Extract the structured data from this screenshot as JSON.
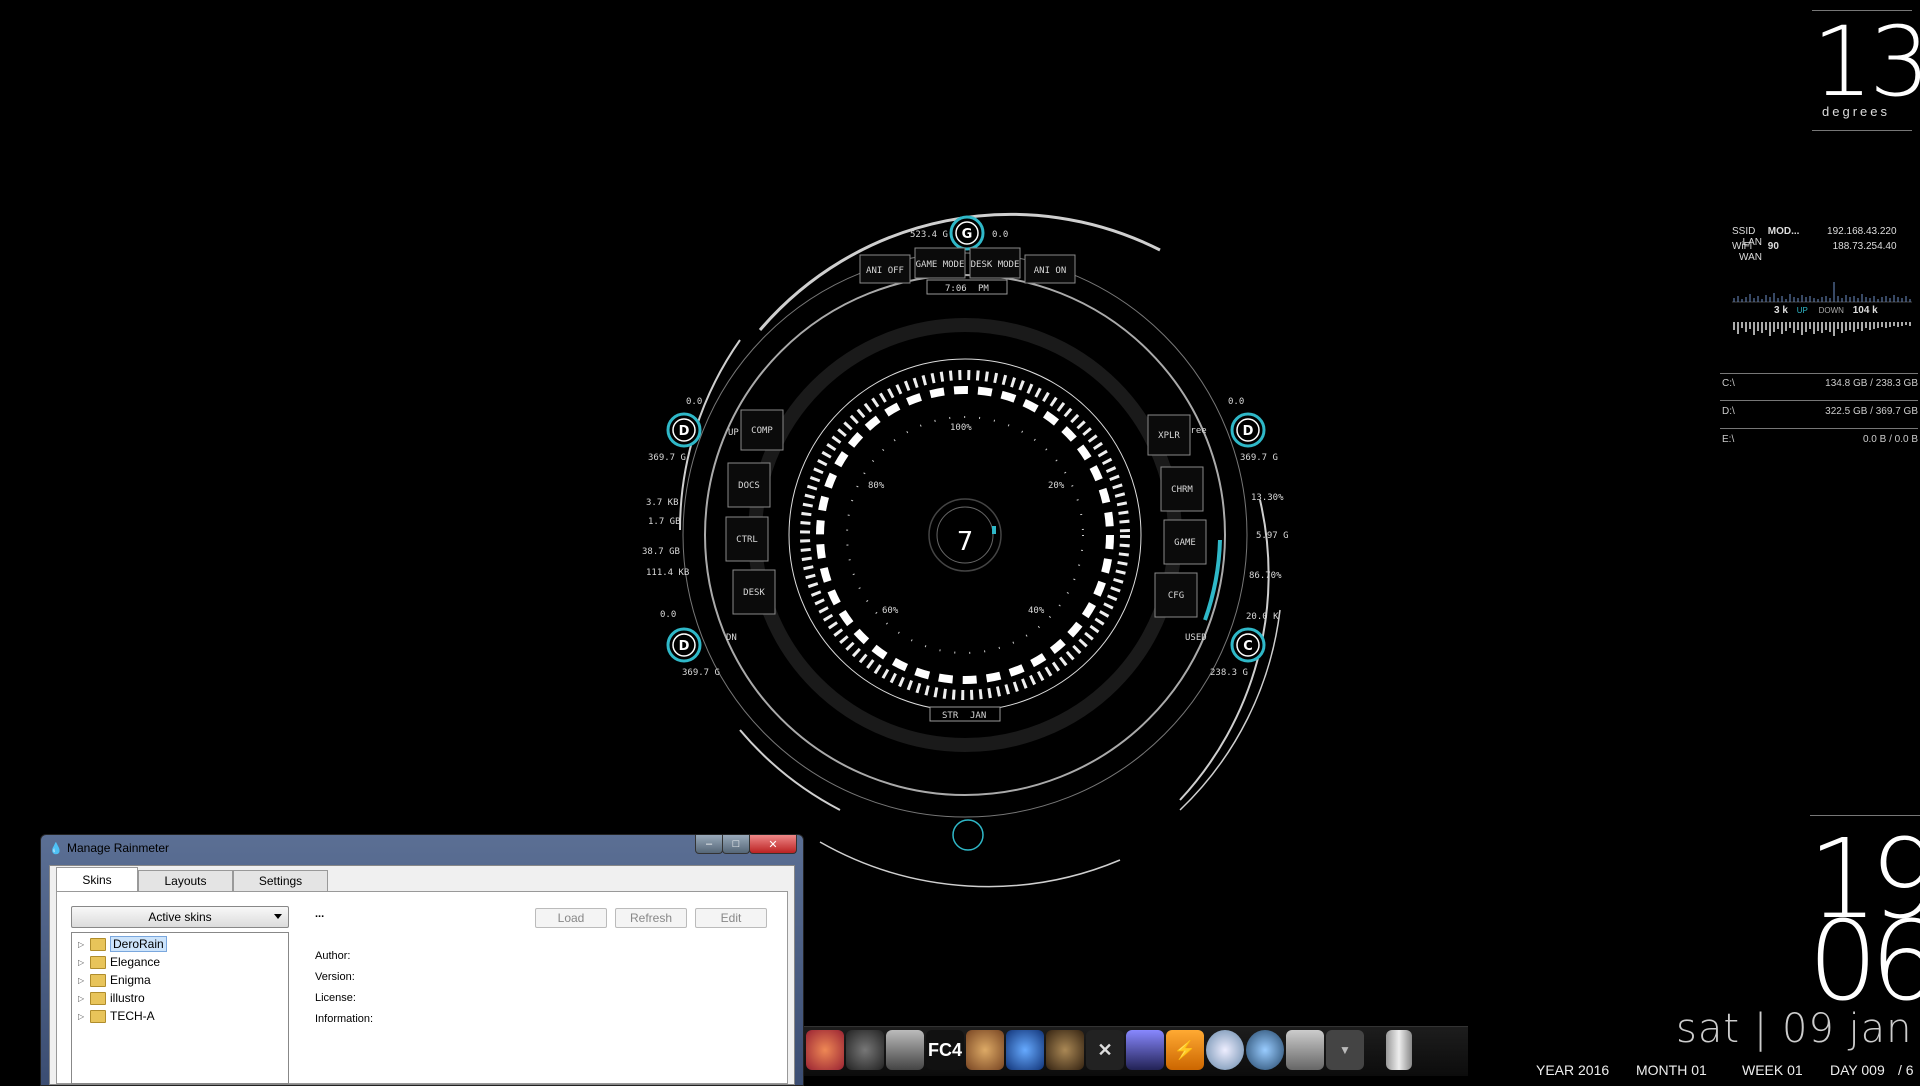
{
  "hud": {
    "top_label": "G",
    "top_left_value": "523.4 G",
    "top_right_value": "0.0",
    "left_disks": [
      {
        "letter": "D",
        "value_top": "0.0",
        "value_bottom": "369.7 G"
      },
      {
        "letter": "D",
        "value_top": "0.0",
        "value_bottom": "369.7 G"
      }
    ],
    "right_disks": [
      {
        "letter": "D",
        "value_top": "0.0",
        "value_bottom": "369.7 G"
      },
      {
        "letter": "C",
        "value_top": "20.0 K",
        "value_bottom": "238.3 G"
      }
    ],
    "left_stats": [
      "3.7 KB",
      "1.7 GB",
      "38.7 GB",
      "111.4 KB"
    ],
    "right_stats": [
      "13.30%",
      "5.97 G",
      "86.70%"
    ],
    "up_label": "UP",
    "dn_label": "DN",
    "free_label": "Free",
    "used_label": "USED",
    "top_buttons": [
      "ANI OFF",
      "GAME MODE",
      "DESK MODE",
      "ANI ON"
    ],
    "left_buttons": [
      "COMP",
      "DOCS",
      "CTRL",
      "DESK"
    ],
    "right_buttons": [
      "XPLR",
      "CHRM",
      "GAME",
      "CFG"
    ],
    "time": "7:06",
    "ampm": "PM",
    "day": "7",
    "weekday_short": "STR",
    "month_short": "JAN",
    "inner_ticks": [
      "100%",
      "80%",
      "20%",
      "60%",
      "40%"
    ]
  },
  "weather": {
    "temp": "13",
    "unit": "degrees"
  },
  "network": {
    "row1": [
      "SSID",
      "MOD...",
      "192.168.43.220",
      "LAN"
    ],
    "row2": [
      "WiFi",
      "90",
      "188.73.254.40",
      "WAN"
    ],
    "up_value": "3 k",
    "up_label": "UP",
    "down_label": "DOWN",
    "down_value": "104 k"
  },
  "drives": [
    {
      "name": "C:\\",
      "usage": "134.8 GB / 238.3 GB"
    },
    {
      "name": "D:\\",
      "usage": "322.5 GB / 369.7 GB"
    },
    {
      "name": "E:\\",
      "usage": "0.0 B / 0.0 B"
    }
  ],
  "clock": {
    "hour": "19",
    "minute": "06",
    "date": "sat  |  09 jan"
  },
  "bottom_stats": [
    "YEAR 2016",
    "MONTH 01",
    "WEEK 01",
    "DAY 009",
    "/ 6"
  ],
  "dock": {
    "icons": [
      "helmet-game-icon",
      "witcher-wolf-icon",
      "dark-souls-icon",
      "fc4-icon",
      "orb-game-icon",
      "heroes-storm-icon",
      "dragon-game-icon",
      "x-launcher-icon",
      "movie-maker-icon",
      "winamp-icon",
      "globe-browser-icon",
      "thunderbird-icon",
      "disk-tool-icon",
      "dock-more-icon",
      "recycle-bin-icon"
    ],
    "fc4_text": "FC4"
  },
  "window": {
    "title": "Manage Rainmeter",
    "tabs": [
      "Skins",
      "Layouts",
      "Settings"
    ],
    "dropdown_label": "Active skins",
    "ellipsis": "...",
    "buttons": [
      "Load",
      "Refresh",
      "Edit"
    ],
    "skins": [
      "DeroRain",
      "Elegance",
      "Enigma",
      "illustro",
      "TECH-A"
    ],
    "meta_labels": [
      "Author:",
      "Version:",
      "License:",
      "Information:"
    ]
  },
  "colors": {
    "accent": "#2fb8c8",
    "background": "#000000"
  }
}
